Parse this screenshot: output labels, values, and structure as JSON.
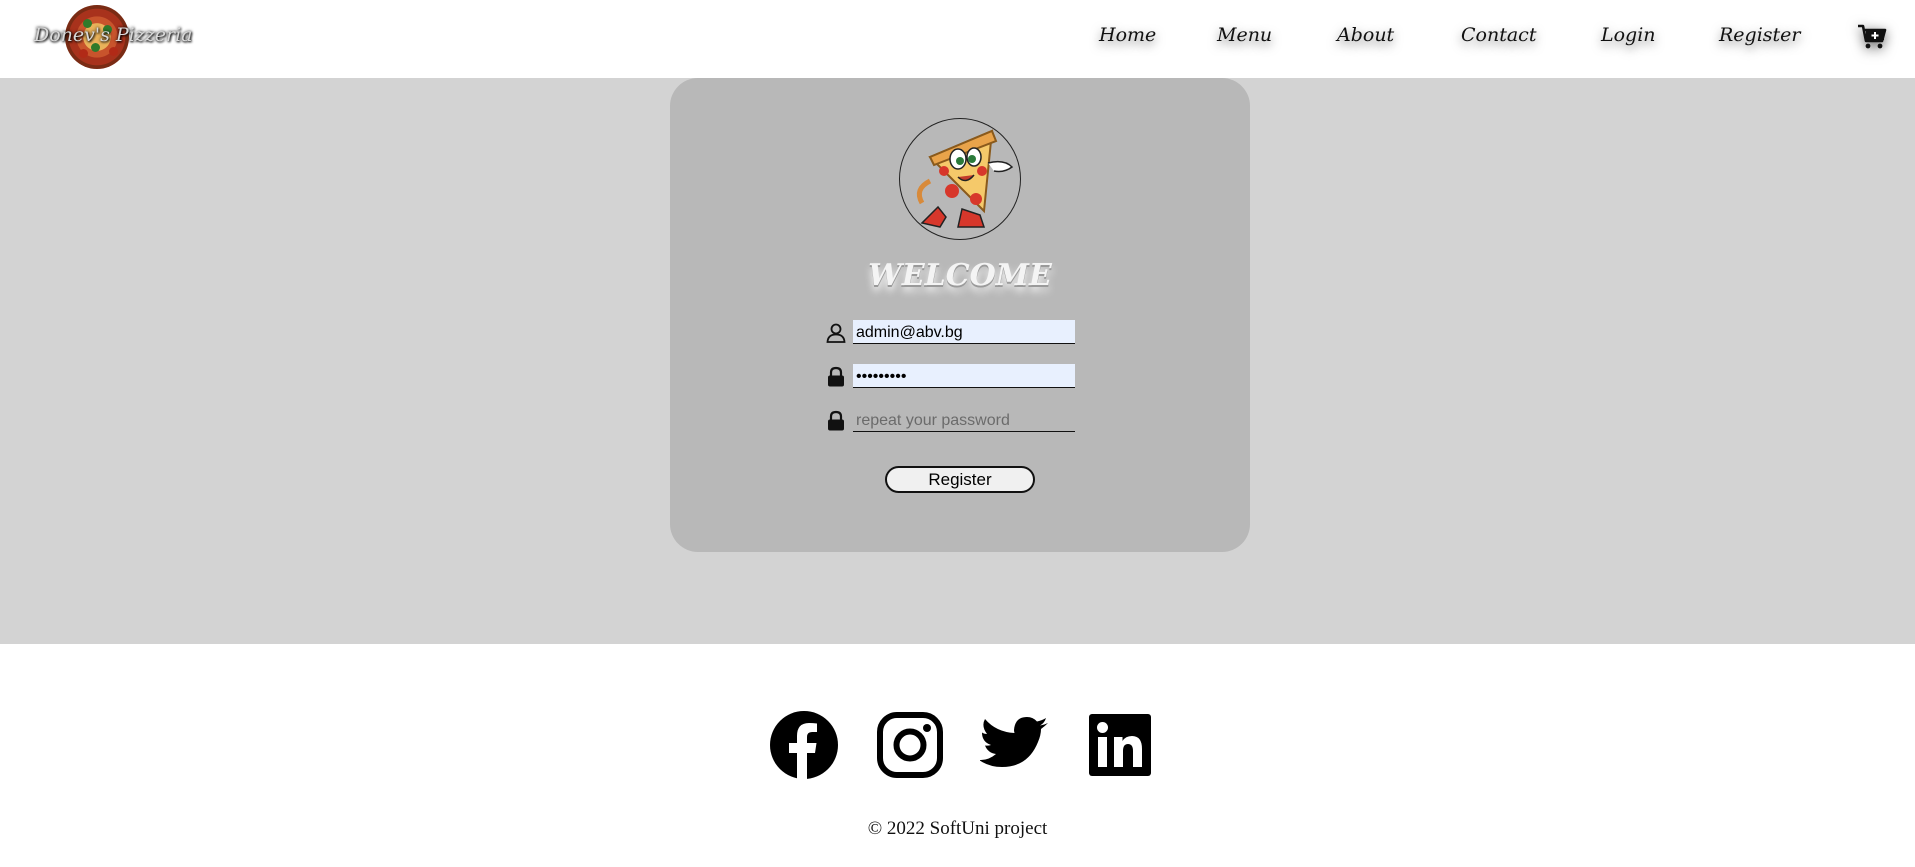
{
  "header": {
    "logo_text": "Donev's Pizzeria",
    "nav": [
      {
        "label": "Home"
      },
      {
        "label": "Menu"
      },
      {
        "label": "About"
      },
      {
        "label": "Contact"
      },
      {
        "label": "Login"
      },
      {
        "label": "Register"
      }
    ],
    "cart_icon": "cart-plus-icon"
  },
  "form": {
    "avatar_icon": "pizza-mascot",
    "title": "WELCOME",
    "email": {
      "value": "admin@abv.bg",
      "icon": "user-icon"
    },
    "password": {
      "value": "•••••••••",
      "icon": "lock-icon"
    },
    "repeat_password": {
      "value": "",
      "placeholder": "repeat your password",
      "icon": "lock-icon"
    },
    "submit_label": "Register"
  },
  "footer": {
    "social": [
      {
        "name": "facebook-icon"
      },
      {
        "name": "instagram-icon"
      },
      {
        "name": "twitter-icon"
      },
      {
        "name": "linkedin-icon"
      }
    ],
    "copyright": "© 2022 SoftUni project"
  },
  "colors": {
    "page_band": "#d3d3d3",
    "card": "#b8b8b8",
    "autofill": "#e8f0fe"
  }
}
